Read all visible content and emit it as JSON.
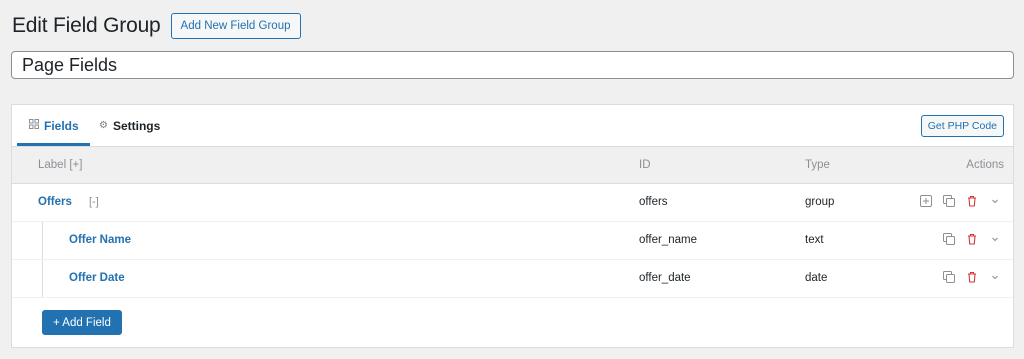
{
  "header": {
    "title": "Edit Field Group",
    "add_new_label": "Add New Field Group"
  },
  "title_input": {
    "value": "Page Fields"
  },
  "tabs": [
    {
      "label": "Fields",
      "icon": "grid-icon",
      "active": true
    },
    {
      "label": "Settings",
      "icon": "gear-icon",
      "active": false
    }
  ],
  "php_button_label": "Get PHP Code",
  "table": {
    "columns": {
      "label": "Label [+]",
      "id": "ID",
      "type": "Type",
      "actions": "Actions"
    },
    "rows": [
      {
        "label": "Offers",
        "toggle": "[-]",
        "id": "offers",
        "type": "group",
        "nested": false,
        "has_add": true
      },
      {
        "label": "Offer Name",
        "id": "offer_name",
        "type": "text",
        "nested": true,
        "has_add": false
      },
      {
        "label": "Offer Date",
        "id": "offer_date",
        "type": "date",
        "nested": true,
        "has_add": false
      }
    ]
  },
  "add_field_label": "+ Add Field",
  "colors": {
    "accent": "#2271b1",
    "danger": "#d63638",
    "muted": "#8c8f94"
  }
}
